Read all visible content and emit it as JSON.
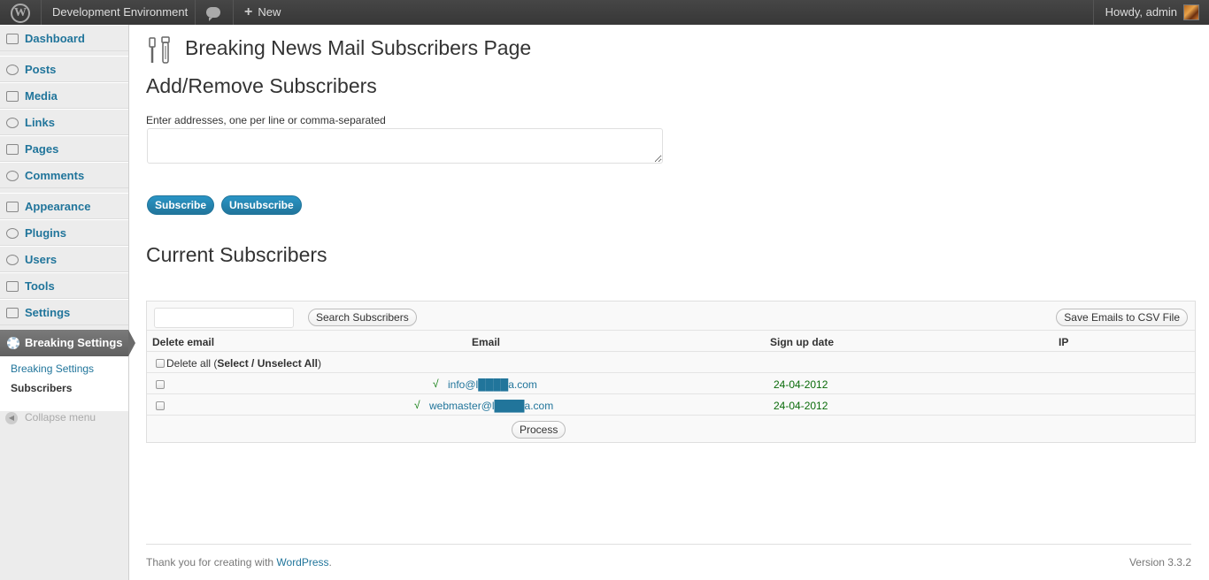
{
  "adminbar": {
    "site_name": "Development Environment",
    "new_label": "New",
    "howdy": "Howdy, admin",
    "icons": [
      "wordpress-logo-icon",
      "comment-bubble-icon",
      "plus-icon"
    ]
  },
  "sidebar": {
    "items": [
      {
        "label": "Dashboard",
        "icon": "dashboard-icon"
      },
      {
        "label": "Posts",
        "icon": "pin-icon"
      },
      {
        "label": "Media",
        "icon": "media-icon"
      },
      {
        "label": "Links",
        "icon": "link-icon"
      },
      {
        "label": "Pages",
        "icon": "pages-icon"
      },
      {
        "label": "Comments",
        "icon": "comments-icon"
      },
      {
        "label": "Appearance",
        "icon": "appearance-icon"
      },
      {
        "label": "Plugins",
        "icon": "plugins-icon"
      },
      {
        "label": "Users",
        "icon": "users-icon"
      },
      {
        "label": "Tools",
        "icon": "tools-icon"
      },
      {
        "label": "Settings",
        "icon": "settings-icon"
      }
    ],
    "active": {
      "label": "Breaking Settings",
      "icon": "gear-icon"
    },
    "submenu": [
      "Breaking Settings",
      "Subscribers"
    ],
    "collapse": "Collapse menu"
  },
  "main": {
    "page_title": "Breaking News Mail Subscribers Page",
    "add_heading": "Add/Remove Subscribers",
    "addr_label": "Enter addresses, one per line or comma-separated",
    "addr_value": "",
    "subscribe": "Subscribe",
    "unsubscribe": "Unsubscribe",
    "current_heading": "Current Subscribers"
  },
  "table": {
    "search_value": "",
    "search_button": "Search Subscribers",
    "csv_button": "Save Emails to CSV File",
    "headers": [
      "Delete email",
      "Email",
      "Sign up date",
      "IP"
    ],
    "delete_all_prefix": "Delete all (",
    "select_all": "Select / Unselect All",
    "delete_all_suffix": ")",
    "rows": [
      {
        "checkmark": "√",
        "email": "info@l████a.com",
        "date": "24-04-2012",
        "ip": ""
      },
      {
        "checkmark": "√",
        "email": "webmaster@l████a.com",
        "date": "24-04-2012",
        "ip": ""
      }
    ],
    "process_button": "Process"
  },
  "footer": {
    "thanks": "Thank you for creating with ",
    "wp_link": "WordPress",
    "period": ".",
    "version": "Version 3.3.2"
  }
}
